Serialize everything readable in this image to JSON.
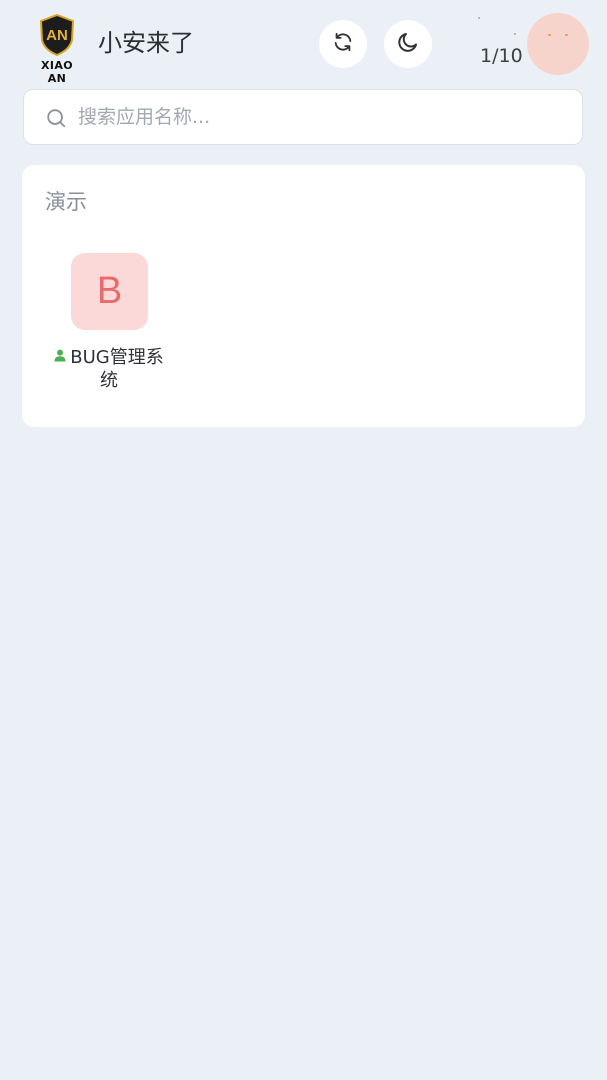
{
  "header": {
    "logo_mark": "AN",
    "logo_caption": "XIAO AN",
    "title": "小安来了",
    "refresh_icon": "refresh-icon",
    "theme_icon": "moon-icon",
    "counter": "1/10"
  },
  "search": {
    "placeholder": "搜索应用名称...",
    "value": ""
  },
  "sections": [
    {
      "title": "演示",
      "apps": [
        {
          "initial": "B",
          "name": "BUG管理系统",
          "icon": "user-icon",
          "icon_bg": "#fbd9d9",
          "icon_color": "#e96a6a"
        }
      ]
    }
  ],
  "colors": {
    "background": "#ebeff6",
    "card": "#ffffff",
    "user_icon": "#4caf50",
    "avatar": "#f6d4cb",
    "logo_gold": "#d9a520"
  }
}
